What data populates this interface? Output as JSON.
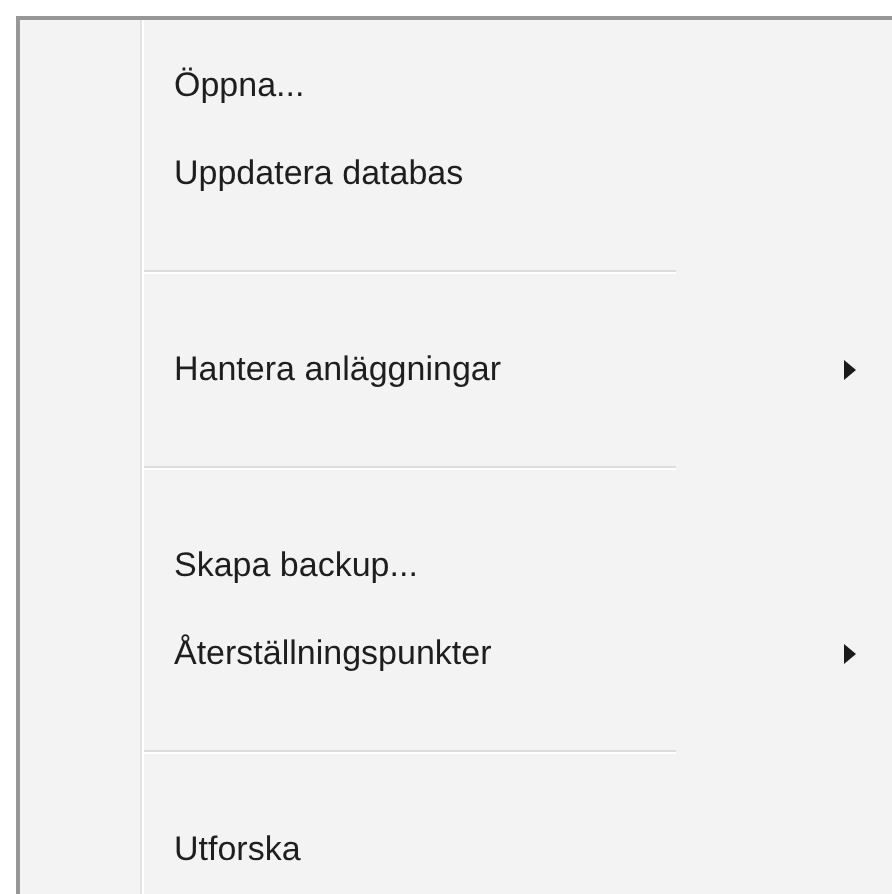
{
  "menu": {
    "items": [
      {
        "kind": "item",
        "label": "Öppna...",
        "submenu": false
      },
      {
        "kind": "item",
        "label": "Uppdatera databas",
        "submenu": false
      },
      {
        "kind": "separator"
      },
      {
        "kind": "item",
        "label": "Hantera anläggningar",
        "submenu": true
      },
      {
        "kind": "separator"
      },
      {
        "kind": "item",
        "label": "Skapa backup...",
        "submenu": false
      },
      {
        "kind": "item",
        "label": "Återställningspunkter",
        "submenu": true
      },
      {
        "kind": "separator"
      },
      {
        "kind": "item",
        "label": "Utforska",
        "submenu": false
      }
    ]
  }
}
